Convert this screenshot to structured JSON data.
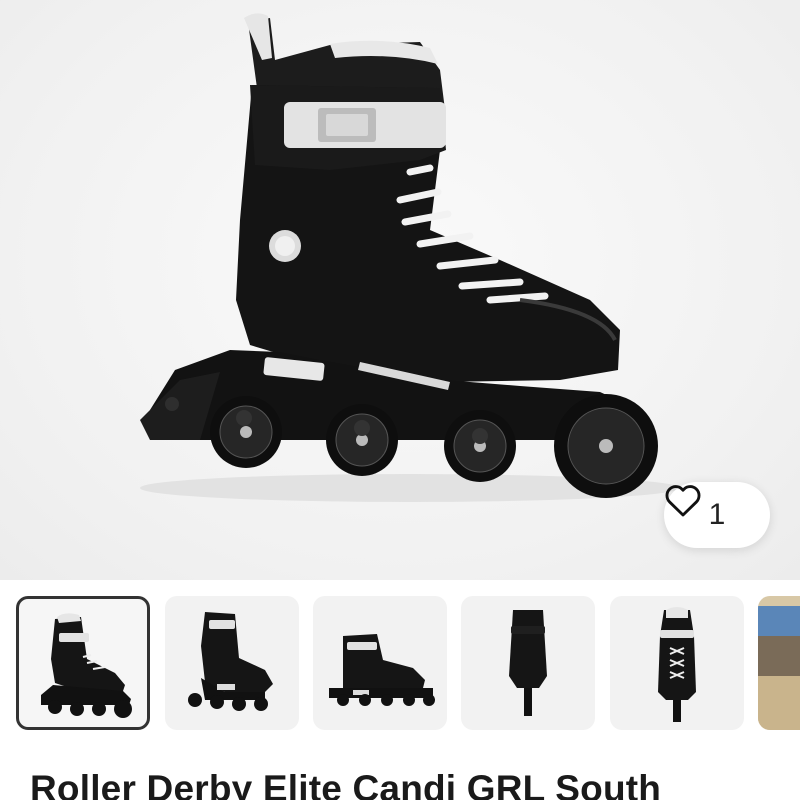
{
  "product": {
    "title": "Roller Derby Elite Candi GRL South",
    "like_count": "1",
    "selected_image_index": 0
  },
  "thumbnails": [
    {
      "view": "side-view"
    },
    {
      "view": "angled-view"
    },
    {
      "view": "low-side-view"
    },
    {
      "view": "back-view"
    },
    {
      "view": "front-view"
    },
    {
      "view": "lifestyle-photo"
    }
  ],
  "icons": {
    "like": "heart-outline-icon"
  },
  "colors": {
    "skate": "#111111",
    "accent": "#ededed",
    "background": "#f2f2f2"
  }
}
